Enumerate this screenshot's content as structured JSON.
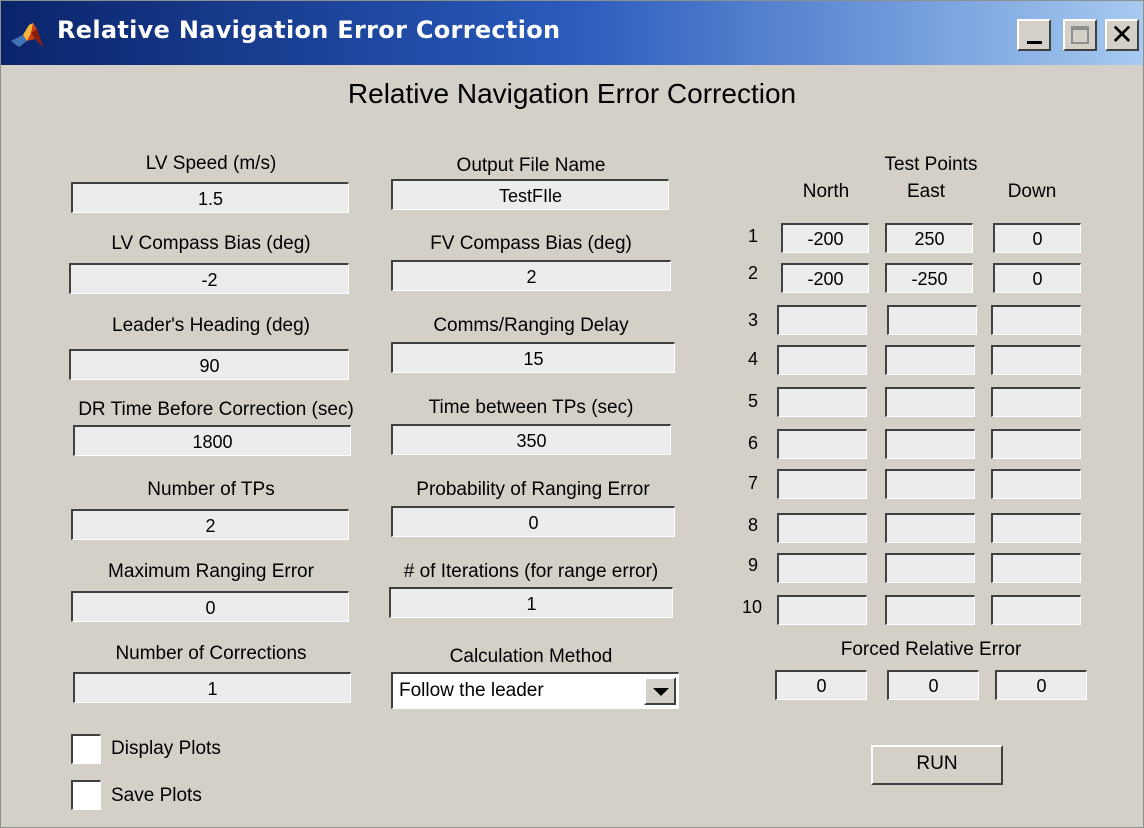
{
  "window": {
    "title": "Relative Navigation Error Correction"
  },
  "heading": "Relative Navigation Error Correction",
  "left": [
    {
      "label": "LV Speed (m/s)",
      "value": "1.5"
    },
    {
      "label": "LV Compass Bias (deg)",
      "value": "-2"
    },
    {
      "label": "Leader's Heading (deg)",
      "value": "90"
    },
    {
      "label": "DR Time Before Correction (sec)",
      "value": "1800"
    },
    {
      "label": "Number of TPs",
      "value": "2"
    },
    {
      "label": "Maximum Ranging Error",
      "value": "0"
    },
    {
      "label": "Number of Corrections",
      "value": "1"
    }
  ],
  "middle": [
    {
      "label": "Output File Name",
      "value": "TestFIle"
    },
    {
      "label": "FV Compass Bias (deg)",
      "value": "2"
    },
    {
      "label": "Comms/Ranging Delay",
      "value": "15"
    },
    {
      "label": "Time between TPs (sec)",
      "value": "350"
    },
    {
      "label": "Probability of Ranging Error",
      "value": "0"
    },
    {
      "label": "# of Iterations (for range error)",
      "value": "1"
    }
  ],
  "calc": {
    "label": "Calculation Method",
    "selected": "Follow the leader"
  },
  "test_points": {
    "title": "Test Points",
    "columns": [
      "North",
      "East",
      "Down"
    ],
    "rows": [
      {
        "num": "1",
        "north": "-200",
        "east": "250",
        "down": "0"
      },
      {
        "num": "2",
        "north": "-200",
        "east": "-250",
        "down": "0"
      },
      {
        "num": "3",
        "north": "",
        "east": "",
        "down": ""
      },
      {
        "num": "4",
        "north": "",
        "east": "",
        "down": ""
      },
      {
        "num": "5",
        "north": "",
        "east": "",
        "down": ""
      },
      {
        "num": "6",
        "north": "",
        "east": "",
        "down": ""
      },
      {
        "num": "7",
        "north": "",
        "east": "",
        "down": ""
      },
      {
        "num": "8",
        "north": "",
        "east": "",
        "down": ""
      },
      {
        "num": "9",
        "north": "",
        "east": "",
        "down": ""
      },
      {
        "num": "10",
        "north": "",
        "east": "",
        "down": ""
      }
    ]
  },
  "forced_error": {
    "label": "Forced Relative Error",
    "values": [
      "0",
      "0",
      "0"
    ]
  },
  "checkboxes": {
    "display_plots": "Display Plots",
    "save_plots": "Save Plots"
  },
  "run_label": "RUN"
}
